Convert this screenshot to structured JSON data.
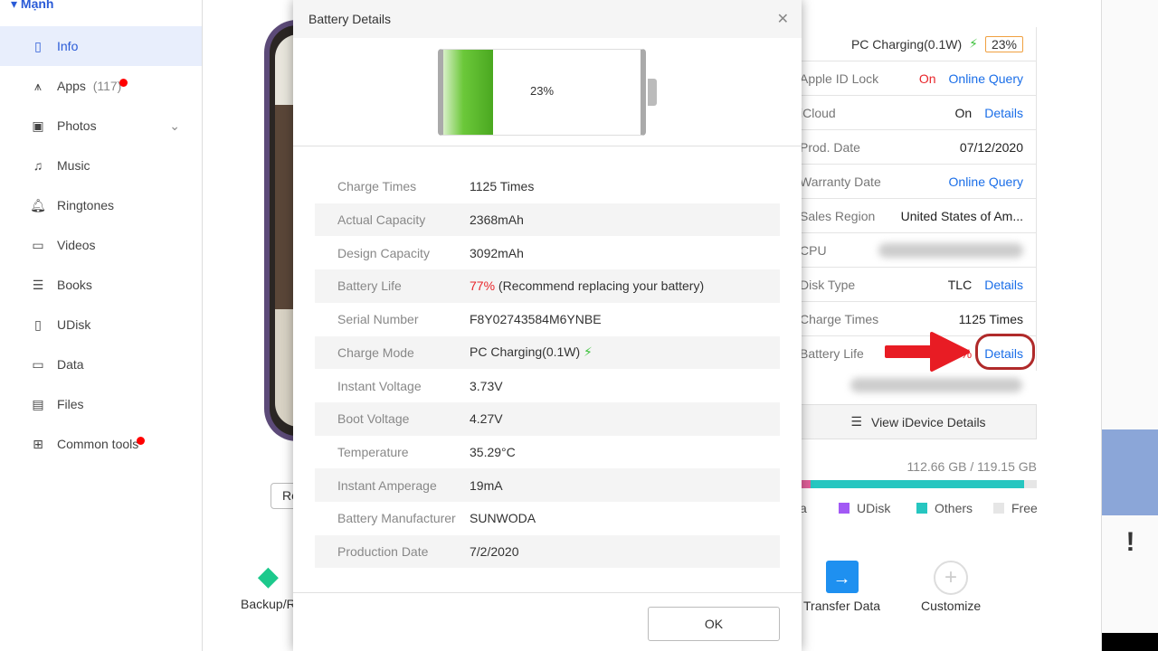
{
  "sidebar": {
    "device": "Mạnh",
    "items": [
      {
        "label": "Info"
      },
      {
        "label": "Apps",
        "count": "(117)"
      },
      {
        "label": "Photos"
      },
      {
        "label": "Music"
      },
      {
        "label": "Ringtones"
      },
      {
        "label": "Videos"
      },
      {
        "label": "Books"
      },
      {
        "label": "UDisk"
      },
      {
        "label": "Data"
      },
      {
        "label": "Files"
      },
      {
        "label": "Common tools"
      }
    ]
  },
  "main": {
    "re_button": "Re",
    "tools": [
      "Backup/R",
      "Transfer Data",
      "Customize"
    ]
  },
  "info": {
    "charging": "PC Charging(0.1W)",
    "battery_pct": "23%",
    "rows": [
      {
        "label": "Apple ID Lock",
        "value": "On",
        "link": "Online Query"
      },
      {
        "label": "iCloud",
        "value": "On",
        "link": "Details"
      },
      {
        "label": "Prod. Date",
        "value": "07/12/2020"
      },
      {
        "label": "Warranty Date",
        "link": "Online Query"
      },
      {
        "label": "Sales Region",
        "value": "United States of Am..."
      },
      {
        "label": "CPU"
      },
      {
        "label": "Disk Type",
        "value": "TLC",
        "link": "Details"
      },
      {
        "label": "Charge Times",
        "value": "1125 Times"
      },
      {
        "label": "Battery Life",
        "value": "77%",
        "link": "Details"
      }
    ],
    "view_details": "View iDevice Details",
    "storage": "112.66 GB / 119.15 GB",
    "storage_used_fraction": 0.945,
    "legend": [
      "a",
      "UDisk",
      "Others",
      "Free"
    ]
  },
  "modal": {
    "title": "Battery Details",
    "battery_level": "23%",
    "battery_fraction": 0.23,
    "rows": [
      {
        "k": "Charge Times",
        "v": "1125 Times"
      },
      {
        "k": "Actual Capacity",
        "v": "2368mAh"
      },
      {
        "k": "Design Capacity",
        "v": "3092mAh"
      },
      {
        "k": "Battery Life",
        "v": "77%",
        "note": " (Recommend replacing your battery)"
      },
      {
        "k": "Serial Number",
        "v": "F8Y02743584M6YNBE"
      },
      {
        "k": "Charge Mode",
        "v": "PC Charging(0.1W)"
      },
      {
        "k": "Instant Voltage",
        "v": "3.73V"
      },
      {
        "k": "Boot Voltage",
        "v": "4.27V"
      },
      {
        "k": "Temperature",
        "v": "35.29°C"
      },
      {
        "k": "Instant Amperage",
        "v": "19mA"
      },
      {
        "k": "Battery Manufacturer",
        "v": "SUNWODA"
      },
      {
        "k": "Production Date",
        "v": "7/2/2020"
      }
    ],
    "ok": "OK"
  },
  "colors": {
    "accent": "#2a5bd7",
    "link": "#1a6ee8",
    "warning": "#e8262b",
    "charge": "#3cc13b",
    "others": "#26c6c0",
    "udisk": "#a259f5"
  }
}
